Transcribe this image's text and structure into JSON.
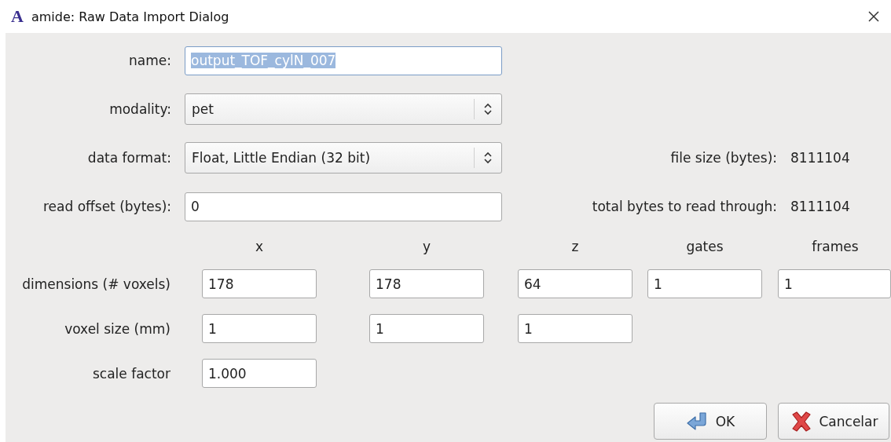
{
  "window": {
    "logo": "A",
    "title": "amide: Raw Data Import Dialog"
  },
  "fields": [
    {
      "label": "name:",
      "kind": "text",
      "value": "output_TOF_cylN_007",
      "selected": true
    },
    {
      "label": "modality:",
      "kind": "combo",
      "value": "pet"
    },
    {
      "label": "data format:",
      "kind": "combo",
      "value": "Float, Little Endian (32 bit)",
      "info_label": "file size (bytes):",
      "info_value": "8111104"
    },
    {
      "label": "read offset (bytes):",
      "kind": "text",
      "value": "0",
      "selected": false,
      "info_label": "total bytes to read through:",
      "info_value": "8111104"
    }
  ],
  "grid": {
    "columns": [
      "x",
      "y",
      "z",
      "gates",
      "frames"
    ],
    "rows": [
      {
        "label": "dimensions (# voxels)",
        "values": [
          "178",
          "178",
          "64",
          "1",
          "1"
        ]
      },
      {
        "label": "voxel size (mm)",
        "values": [
          "1",
          "1",
          "1"
        ]
      },
      {
        "label": "scale factor",
        "values": [
          "1.000"
        ]
      }
    ]
  },
  "buttons": [
    {
      "label": "OK",
      "kind": "ok"
    },
    {
      "label": "Cancelar",
      "kind": "cancel"
    }
  ]
}
